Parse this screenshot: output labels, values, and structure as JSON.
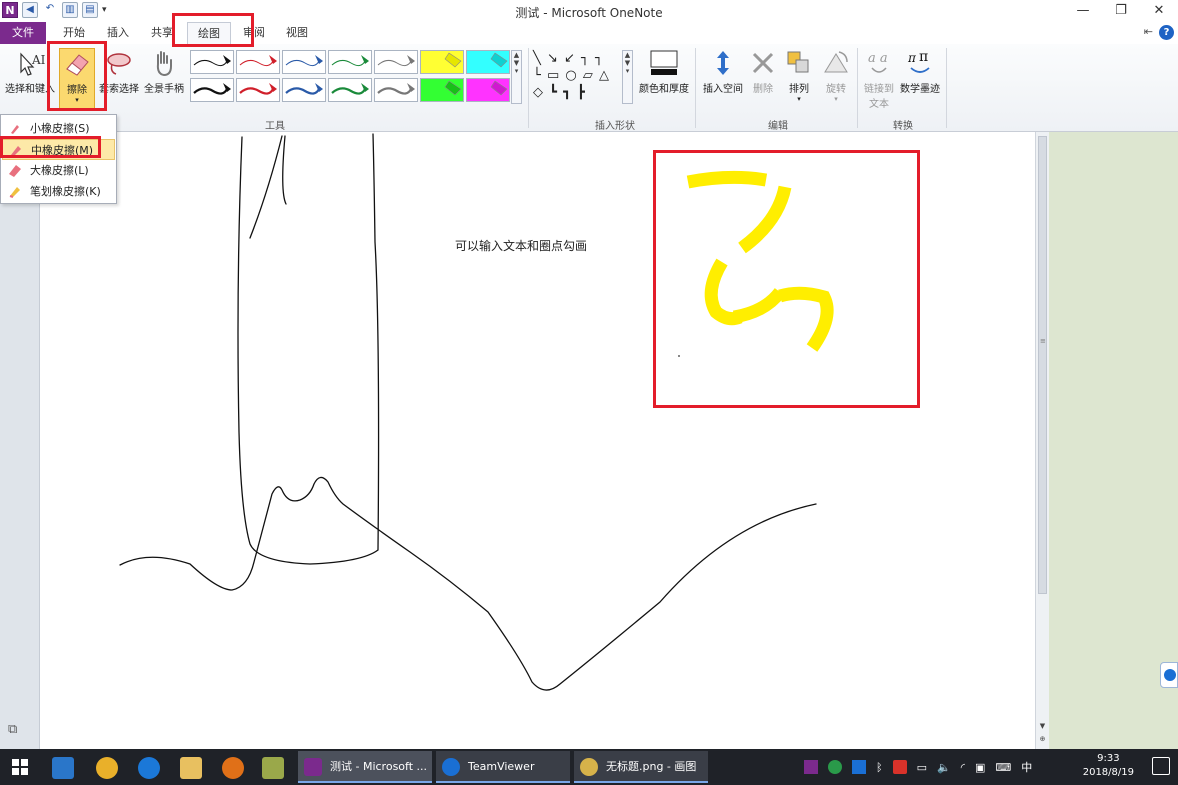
{
  "window": {
    "title": "测试 - Microsoft OneNote",
    "app_logo": "N"
  },
  "tabs": [
    {
      "label": "文件"
    },
    {
      "label": "开始"
    },
    {
      "label": "插入"
    },
    {
      "label": "共享"
    },
    {
      "label": "绘图"
    },
    {
      "label": "审阅"
    },
    {
      "label": "视图"
    }
  ],
  "active_tab": "绘图",
  "ribbon": {
    "tools": {
      "select_label": "选择和键入",
      "erase_label": "擦除",
      "lasso_label": "套索选择",
      "pan_label": "全景手柄",
      "group_label": "工具"
    },
    "insert_shapes": {
      "group_label": "插入形状",
      "color_thickness_label": "颜色和厚度"
    },
    "edit": {
      "insert_space_label": "插入空间",
      "delete_label": "删除",
      "arrange_label": "排列",
      "rotate_label": "旋转",
      "group_label": "编辑"
    },
    "convert": {
      "ink_to_text_label": "链接到文本",
      "ink_to_math_label": "数学墨迹",
      "group_label": "转换"
    }
  },
  "eraser_menu": {
    "items": [
      {
        "label": "小橡皮擦(S)"
      },
      {
        "label": "中橡皮擦(M)"
      },
      {
        "label": "大橡皮擦(L)"
      },
      {
        "label": "笔划橡皮擦(K)"
      }
    ],
    "highlighted": "中橡皮擦(M)"
  },
  "canvas": {
    "note_text": "可以输入文本和圈点勾画",
    "ink_color": "#111111",
    "highlighter_color": "#ffee00"
  },
  "taskbar": {
    "tasks": [
      {
        "label": "测试 - Microsoft ..."
      },
      {
        "label": "TeamViewer"
      },
      {
        "label": "无标题.png - 画图"
      }
    ],
    "ime": "中",
    "time": "9:33",
    "date": "2018/8/19"
  },
  "colors": {
    "file_tab": "#7b2a8d",
    "annotation_red": "#e31d2a",
    "menu_highlight": "#fde9a8",
    "taskbar_bg": "#1f2228"
  }
}
